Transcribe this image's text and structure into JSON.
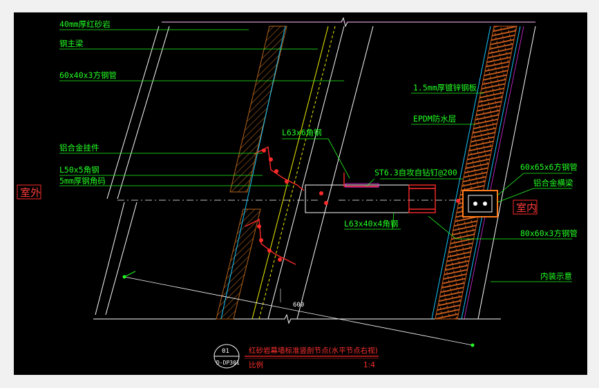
{
  "labels": {
    "stone_panel": "40mm厚红砂岩",
    "main_beam": "钢主梁",
    "square_tube_60x40": "60x40x3方钢管",
    "aluminum_hanger": "铝合金挂件",
    "angle_l50": "L50x5角钢",
    "angle_code_5mm": "5mm厚钢角码",
    "angle_l63x6": "L63x6角钢",
    "screw_st63": "ST6.3自攻自钻钉@200",
    "angle_l63x40": "L63x40x4角钢",
    "galvanized_plate": "1.5mm厚镀锌钢板",
    "epdm_layer": "EPDM防水层",
    "tube_60x65": "60x65x6方钢管",
    "aluminum_beam": "铝合金横梁",
    "tube_80x60": "80x60x3方钢管",
    "interior_note": "内装示意",
    "dim_600": "600"
  },
  "zones": {
    "exterior": "室外",
    "interior": "室内"
  },
  "title_block": {
    "number": "01",
    "sheet": "D-DP301",
    "title": "红砂岩幕墙标准竖剖节点(水平节点右视)",
    "scale_label": "比例",
    "scale_value": "1:4"
  },
  "colors": {
    "background": "#000000",
    "leader": "#22ff22",
    "section": "#ff2a2a",
    "hatch_brown": "#b5651d",
    "cyan": "#16c8ff",
    "yellow": "#f2f200",
    "magenta": "#ff33ff"
  }
}
